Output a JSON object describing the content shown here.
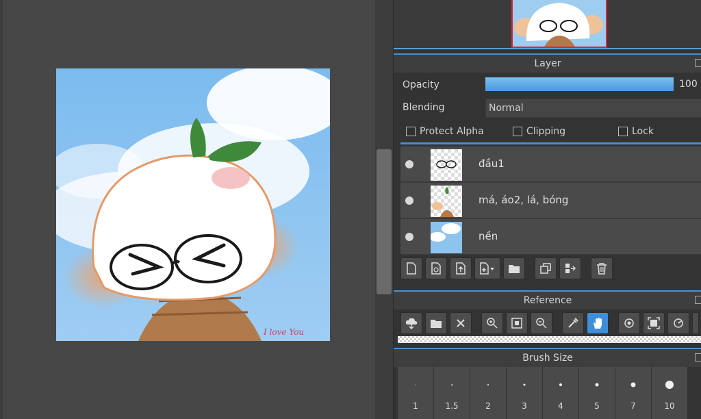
{
  "layer_panel": {
    "title": "Layer",
    "opacity_label": "Opacity",
    "opacity_value": "100 %",
    "opacity_fraction": 1.0,
    "blending_label": "Blending",
    "blending_value": "Normal",
    "protect_alpha_label": "Protect Alpha",
    "clipping_label": "Clipping",
    "lock_label": "Lock",
    "layers": [
      {
        "name": "đầu1"
      },
      {
        "name": "má, áo2, lá, bóng"
      },
      {
        "name": "nền"
      }
    ]
  },
  "artwork": {
    "signature": "I love You"
  },
  "reference_panel": {
    "title": "Reference"
  },
  "brush_panel": {
    "title": "Brush Size",
    "sizes": [
      "1",
      "1.5",
      "2",
      "3",
      "4",
      "5",
      "7",
      "10"
    ]
  },
  "colors": {
    "accent": "#4b8fcc",
    "active_button": "#3d8fd8",
    "nav_frame": "#d7263d"
  }
}
